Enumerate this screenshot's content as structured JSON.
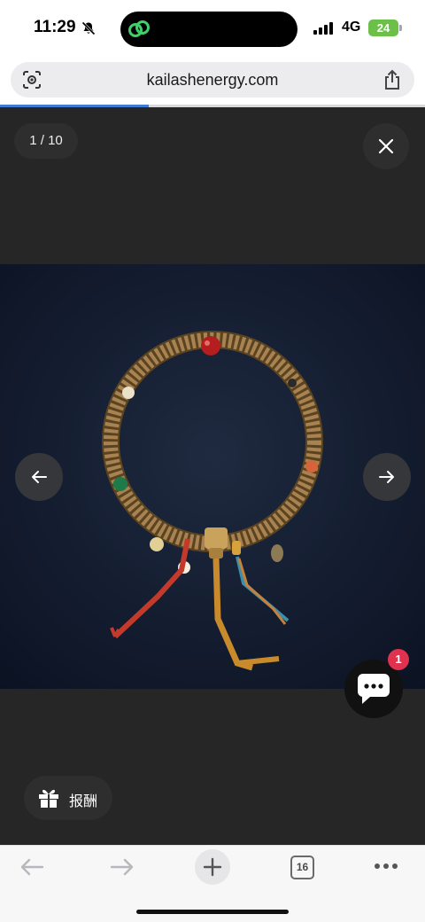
{
  "status_bar": {
    "time": "11:29",
    "network": "4G",
    "battery": "24"
  },
  "browser": {
    "url": "kailashenergy.com",
    "open_tabs": "16",
    "load_progress": 0.35
  },
  "lightbox": {
    "counter": "1 / 10"
  },
  "chat": {
    "badge_count": "1"
  },
  "reward": {
    "label": "报酬"
  },
  "colors": {
    "accent_blue": "#3d7bd6",
    "badge_red": "#e0314f",
    "battery_green": "#6cc04a",
    "bead_red": "#b41e1e",
    "tassel_orange": "#c88a2a"
  },
  "icons": [
    "bell-muted-icon",
    "link-icon",
    "signal-icon",
    "lens-icon",
    "share-icon",
    "close-icon",
    "arrow-left-icon",
    "arrow-right-icon",
    "chat-icon",
    "gift-icon",
    "back-icon",
    "forward-icon",
    "plus-icon",
    "more-icon"
  ]
}
